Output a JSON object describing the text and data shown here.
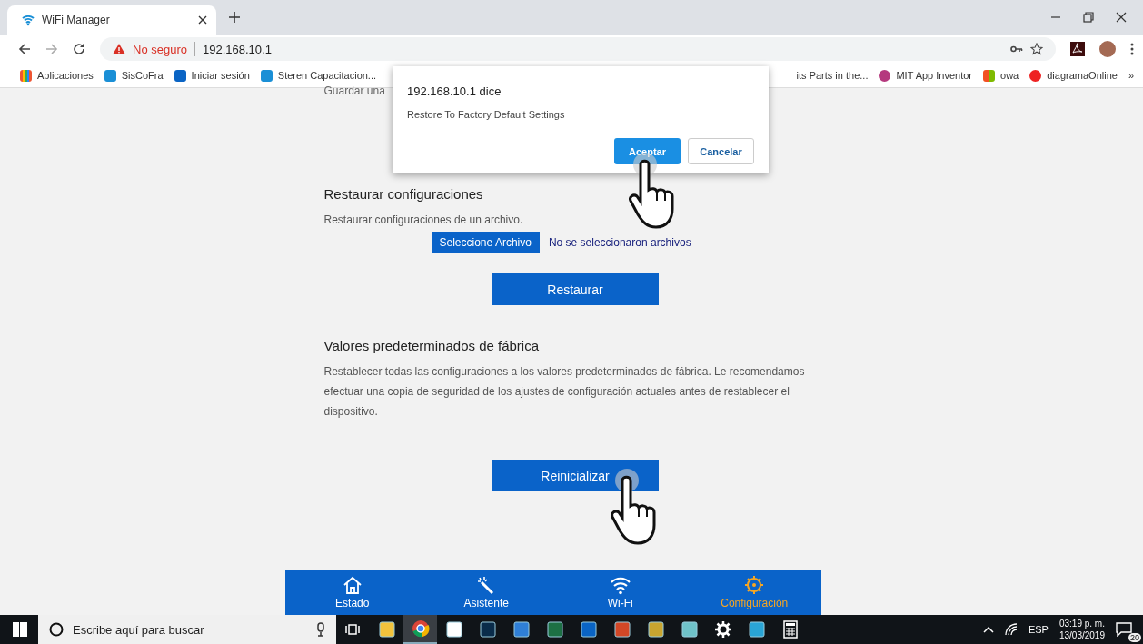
{
  "browser": {
    "tab": {
      "title": "WiFi Manager"
    },
    "security": "No seguro",
    "url": "192.168.10.1",
    "bookmarks_left": [
      "Aplicaciones",
      "SisCoFra",
      "Iniciar sesión",
      "Steren Capacitacion..."
    ],
    "bookmarks_right": [
      "its Parts in the...",
      "MIT App Inventor",
      "owa",
      "diagramaOnline"
    ],
    "bookmarks_more": "»"
  },
  "page": {
    "cut_text": "Guardar una",
    "restore": {
      "heading": "Restaurar configuraciones",
      "description": "Restaurar configuraciones de un archivo.",
      "file_button": "Seleccione Archivo",
      "file_status": "No se seleccionaron archivos",
      "button": "Restaurar"
    },
    "factory": {
      "heading": "Valores predeterminados de fábrica",
      "description": "Restablecer todas las configuraciones a los valores predeterminados de fábrica. Le recomendamos efectuar una copia de seguridad de los ajustes de configuración actuales antes de restablecer el dispositivo.",
      "button": "Reinicializar"
    },
    "nav": [
      {
        "label": "Estado",
        "kind": "home",
        "selected": false
      },
      {
        "label": "Asistente",
        "kind": "wand",
        "selected": false
      },
      {
        "label": "Wi-Fi",
        "kind": "wifi",
        "selected": false
      },
      {
        "label": "Configuración",
        "kind": "gear",
        "selected": true
      }
    ]
  },
  "dialog": {
    "title": "192.168.10.1 dice",
    "message": "Restore To Factory Default Settings",
    "ok": "Aceptar",
    "cancel": "Cancelar"
  },
  "taskbar": {
    "search_placeholder": "Escribe aquí para buscar",
    "language": "ESP",
    "time": "03:19 p. m.",
    "date": "13/03/2019",
    "notifications": "20",
    "apps": [
      {
        "kind": "taskview",
        "selected": false
      },
      {
        "kind": "folder",
        "selected": false
      },
      {
        "kind": "chrome",
        "selected": true
      },
      {
        "kind": "notes",
        "selected": false
      },
      {
        "kind": "ps",
        "selected": false
      },
      {
        "kind": "vs",
        "selected": false
      },
      {
        "kind": "excel",
        "selected": false
      },
      {
        "kind": "outlook",
        "selected": false
      },
      {
        "kind": "ppt",
        "selected": false
      },
      {
        "kind": "tools",
        "selected": false
      },
      {
        "kind": "pad",
        "selected": false
      },
      {
        "kind": "settings",
        "selected": false
      },
      {
        "kind": "remote",
        "selected": false
      },
      {
        "kind": "calc",
        "selected": false
      }
    ]
  }
}
